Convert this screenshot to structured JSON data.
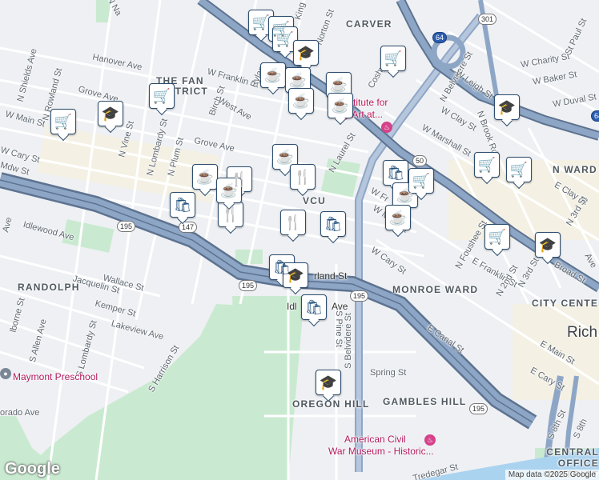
{
  "attribution": "Map data ©2025 Google",
  "logo": "Google",
  "colors": {
    "land": "#eef0f3",
    "park": "#c9ead0",
    "highway": "#8ea6c6",
    "highway_casing": "#5d7390",
    "road": "#ffffff",
    "pin_icon": "#1f4e79",
    "poi_text": "#c0185a"
  },
  "district_labels": [
    "CARVER",
    "THE FAN DISTRICT",
    "VCU",
    "RANDOLPH",
    "MONROE WARD",
    "CITY CENTER",
    "OREGON HILL",
    "GAMBLES HILL",
    "CENTRAL OFFICE DISTRICT",
    "N WARD"
  ],
  "city_label": "Rich",
  "street_labels": [
    "N Na",
    "King",
    "Norton St",
    "Hanover Ave",
    "Grove Ave",
    "W Franklin St",
    "Rylan",
    "Birch St",
    "West Ave",
    "N Shields Ave",
    "N Rowland St",
    "W Main St",
    "N Vine St",
    "N Lombardy St",
    "N Plum St",
    "Grove Ave",
    "W Cary St",
    "N Laurel St",
    "Idlewood Ave",
    "Wallace St",
    "Jacquelin St",
    "Kemper St",
    "Lakeview Ave",
    "S Harrison St",
    "S Lombardy St",
    "S Allen Ave",
    "lborne St",
    "orado Ave",
    "N Belvidere St",
    "W Leigh St",
    "N Brook Rd",
    "W Clay St",
    "W Marshall St",
    "W Charity St",
    "W Baker St",
    "W Duval St",
    "St Paul St",
    "W Main St",
    "W Cary St",
    "rland St",
    "Idl",
    "Ave",
    "S Pine St",
    "S Belvidere St",
    "Spring St",
    "E Canal St",
    "E Main St",
    "E Cary St",
    "S 8th St",
    "S 8th",
    "N Foushee St",
    "E Franklin St",
    "N 2nd St",
    "N 3rd St",
    "E Clay St",
    "N 3rd St",
    "Broad St",
    "Tredegar St",
    "Ave",
    "Coshy",
    "Mdw St",
    "Ave",
    "W Fr"
  ],
  "poi_labels": [
    "Institute for",
    "ary Art at...",
    "American Civil",
    "War Museum - Historic...",
    "Maymont Preschool"
  ],
  "route_shields": [
    "301",
    "64",
    "195",
    "147",
    "195",
    "195",
    "195",
    "50",
    "64"
  ],
  "pins": [
    {
      "icon": "shopping-cart"
    },
    {
      "icon": "shopping-cart"
    },
    {
      "icon": "shopping-cart"
    },
    {
      "icon": "shopping-cart"
    },
    {
      "icon": "school"
    },
    {
      "icon": "coffee"
    },
    {
      "icon": "coffee"
    },
    {
      "icon": "coffee"
    },
    {
      "icon": "coffee"
    },
    {
      "icon": "coffee"
    },
    {
      "icon": "shopping-cart"
    },
    {
      "icon": "school"
    },
    {
      "icon": "shopping-cart"
    },
    {
      "icon": "shopping-cart"
    },
    {
      "icon": "school"
    },
    {
      "icon": "coffee"
    },
    {
      "icon": "restaurant"
    },
    {
      "icon": "shopping-bag"
    },
    {
      "icon": "restaurant"
    },
    {
      "icon": "coffee"
    },
    {
      "icon": "restaurant"
    },
    {
      "icon": "restaurant"
    },
    {
      "icon": "shopping-bag"
    },
    {
      "icon": "restaurant"
    },
    {
      "icon": "shopping-bag"
    },
    {
      "icon": "school"
    },
    {
      "icon": "shopping-bag"
    },
    {
      "icon": "school"
    },
    {
      "icon": "shopping-bag"
    },
    {
      "icon": "coffee"
    },
    {
      "icon": "coffee"
    },
    {
      "icon": "shopping-cart"
    },
    {
      "icon": "shopping-cart"
    },
    {
      "icon": "shopping-cart"
    },
    {
      "icon": "shopping-cart"
    },
    {
      "icon": "school"
    },
    {
      "icon": "shopping-cart"
    }
  ]
}
